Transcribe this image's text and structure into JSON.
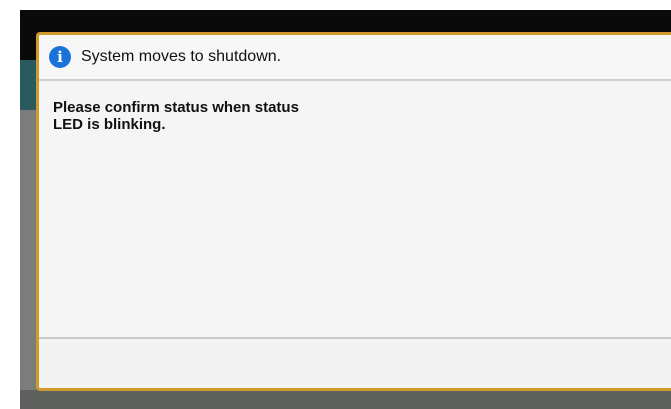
{
  "dialog": {
    "icon": "info-icon",
    "icon_glyph": "i",
    "title": "System moves to shutdown.",
    "message_line1": "Please confirm status when status",
    "message_line2": "LED is blinking."
  },
  "colors": {
    "dialog_border": "#d19a2c",
    "info_icon": "#1a73d9",
    "header_bar": "#0a0a0a",
    "teal_bar": "#2a5a5e"
  }
}
